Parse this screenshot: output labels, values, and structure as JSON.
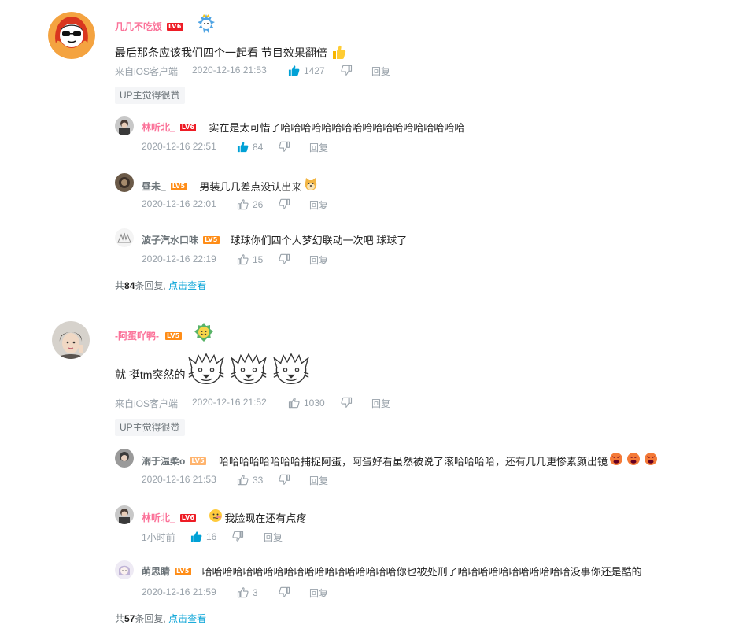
{
  "comments": [
    {
      "username": "几几不吃饭",
      "level": "LV6",
      "text": "最后那条应该我们四个一起看 节目效果翻倍",
      "source": "来自iOS客户端",
      "time": "2020-12-16 21:53",
      "likes": "1427",
      "reply_label": "回复",
      "up_tag": "UP主觉得很赞",
      "replies": [
        {
          "username": "林听北_",
          "level": "LV6",
          "text": "实在是太可惜了哈哈哈哈哈哈哈哈哈哈哈哈哈哈哈哈哈哈",
          "time": "2020-12-16 22:51",
          "likes": "84",
          "reply_label": "回复"
        },
        {
          "username": "昼未_",
          "level": "LV5",
          "text": "男装几几差点没认出来",
          "time": "2020-12-16 22:01",
          "likes": "26",
          "reply_label": "回复"
        },
        {
          "username": "波子汽水口味",
          "level": "LV5",
          "text": "球球你们四个人梦幻联动一次吧 球球了",
          "time": "2020-12-16 22:19",
          "likes": "15",
          "reply_label": "回复"
        }
      ],
      "more": {
        "prefix": "共",
        "count": "84",
        "suffix": "条回复,",
        "link": "点击查看"
      }
    },
    {
      "username": "-阿蛋吖鸭-",
      "level": "LV5",
      "text": "就 挺tm突然的",
      "source": "来自iOS客户端",
      "time": "2020-12-16 21:52",
      "likes": "1030",
      "reply_label": "回复",
      "up_tag": "UP主觉得很赞",
      "replies": [
        {
          "username": "溺于温柔o",
          "level": "LV5",
          "text": "哈哈哈哈哈哈哈哈捕捉阿蛋，阿蛋好看虽然被说了滚哈哈哈哈，还有几几更惨素颜出镜",
          "time": "2020-12-16 21:53",
          "likes": "33",
          "reply_label": "回复"
        },
        {
          "username": "林听北_",
          "level": "LV6",
          "text": "我脸现在还有点疼",
          "time": "1小时前",
          "likes": "16",
          "reply_label": "回复"
        },
        {
          "username": "萌思睛",
          "level": "LV5",
          "text": "哈哈哈哈哈哈哈哈哈哈哈哈哈哈哈哈哈哈哈你也被处刑了哈哈哈哈哈哈哈哈哈哈哈没事你还是酷的",
          "time": "2020-12-16 21:59",
          "likes": "3",
          "reply_label": "回复"
        }
      ],
      "more": {
        "prefix": "共",
        "count": "57",
        "suffix": "条回复,",
        "link": "点击查看"
      }
    }
  ],
  "colors": {
    "vip_pink": "#fb7299",
    "link_blue": "#00a1d6",
    "meta_gray": "#99a2aa",
    "lv6_red": "#ee1c25",
    "lv5_orange": "#ff8d17",
    "liked_blue": "#00a1d6"
  }
}
